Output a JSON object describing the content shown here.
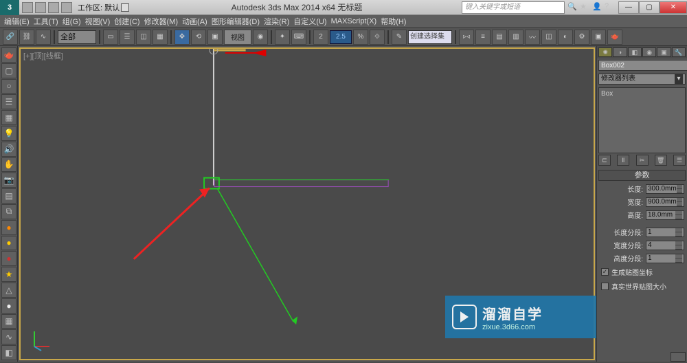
{
  "titlebar": {
    "workspace_label": "工作区: 默认",
    "app_title": "Autodesk 3ds Max  2014 x64    无标题",
    "search_placeholder": "键入关键字或短语"
  },
  "menu": {
    "items": [
      "编辑(E)",
      "工具(T)",
      "组(G)",
      "视图(V)",
      "创建(C)",
      "修改器(M)",
      "动画(A)",
      "图形编辑器(D)",
      "渲染(R)",
      "自定义(U)",
      "MAXScript(X)",
      "帮助(H)"
    ]
  },
  "toolbar": {
    "all_dropdown": "全部",
    "view_dropdown": "视图",
    "angle_value": "2.5",
    "selset": "创建选择集"
  },
  "viewport": {
    "label": "[+][顶][线框]"
  },
  "cmd": {
    "object_name": "Box002",
    "mod_dropdown": "修改器列表",
    "mod_stack_item": "Box",
    "rollout_title": "参数",
    "params": {
      "length_label": "长度:",
      "length_value": "300.0mm",
      "width_label": "宽度:",
      "width_value": "900.0mm",
      "height_label": "高度:",
      "height_value": "18.0mm",
      "lseg_label": "长度分段:",
      "lseg_value": "1",
      "wseg_label": "宽度分段:",
      "4": "4",
      "hseg_label": "高度分段:",
      "hseg_value": "1"
    },
    "chk_genmap": "生成贴图坐标",
    "chk_realworld": "真实世界贴图大小"
  },
  "watermark": {
    "title": "溜溜自学",
    "url": "zixue.3d66.com"
  }
}
